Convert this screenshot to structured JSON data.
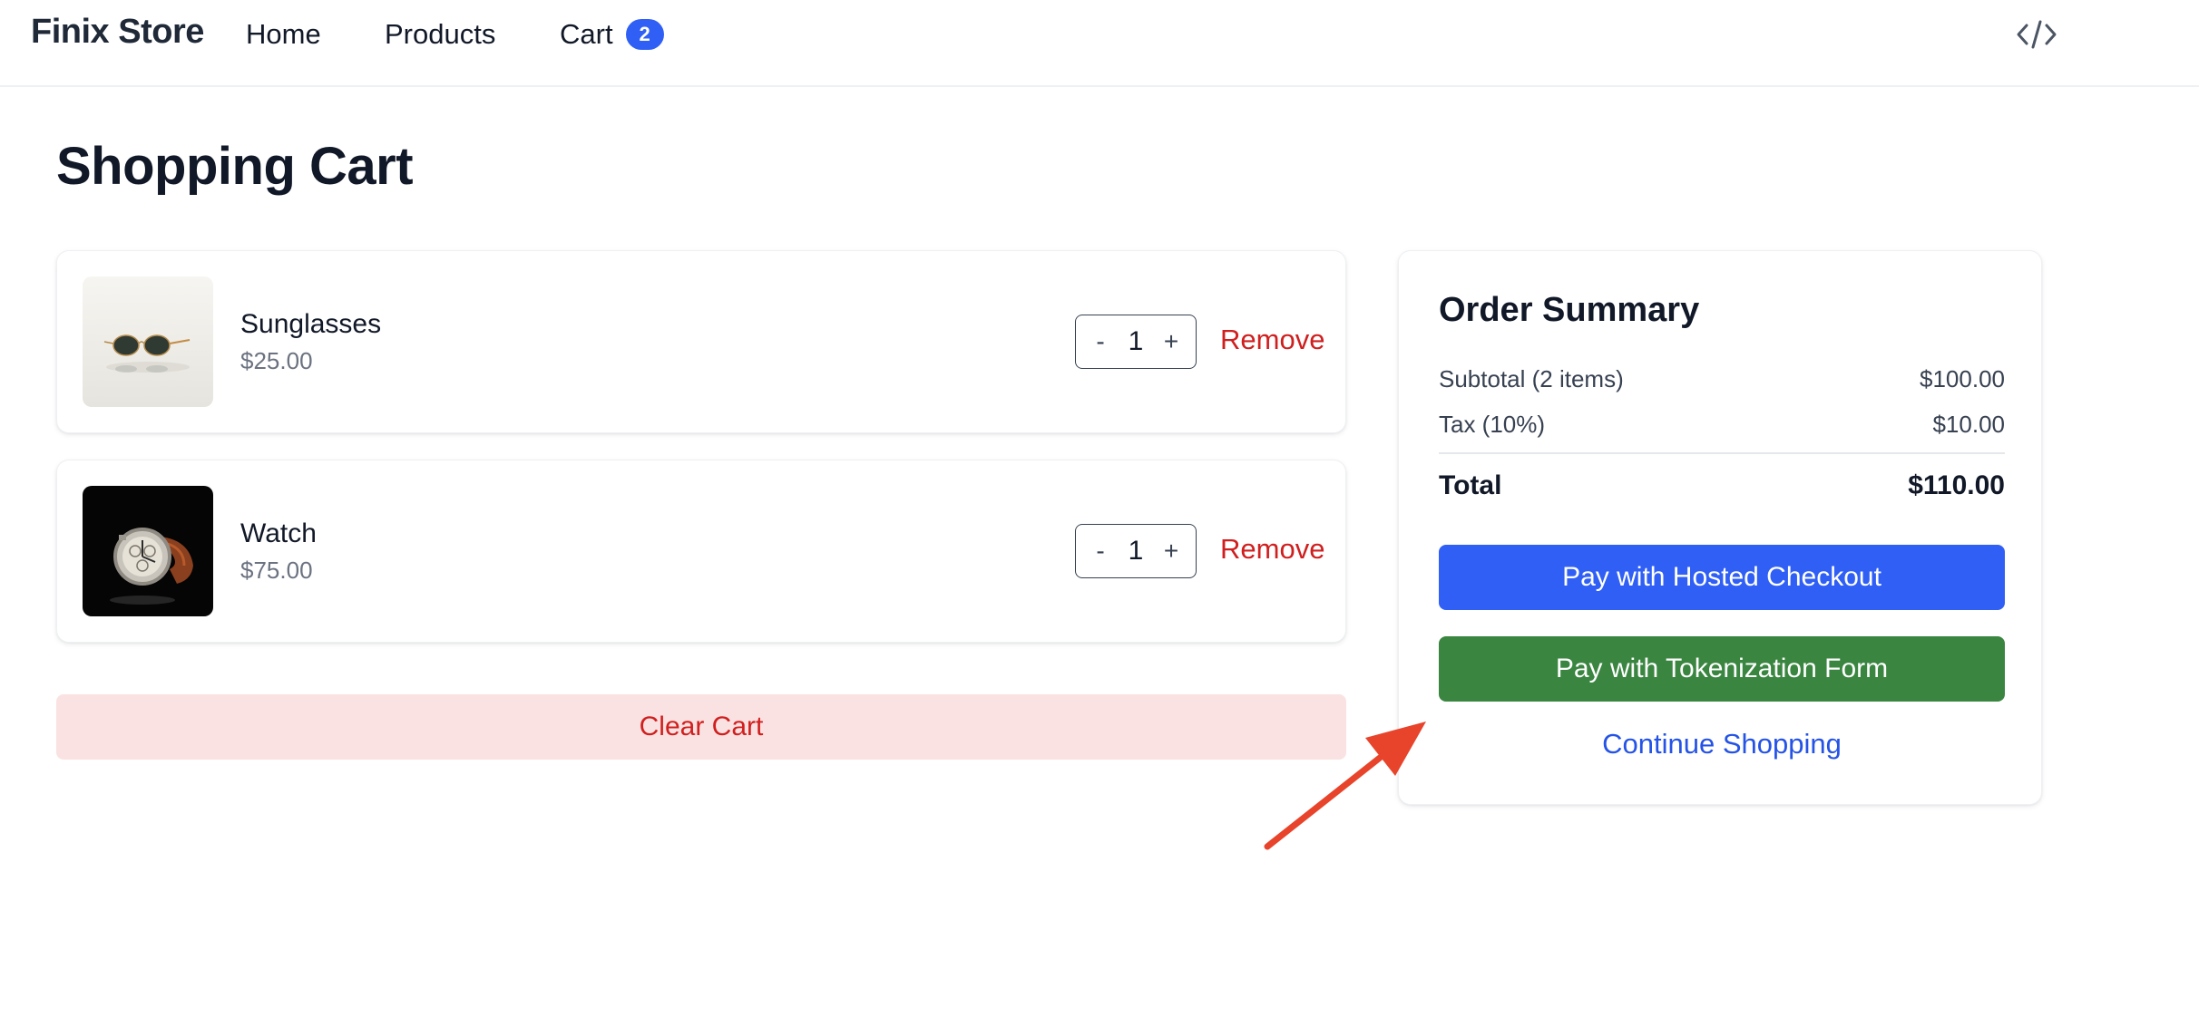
{
  "navbar": {
    "brand": "Finix Store",
    "links": {
      "home": "Home",
      "products": "Products",
      "cart": "Cart"
    },
    "cart_count": "2",
    "dev_icon": "code-icon"
  },
  "page": {
    "title": "Shopping Cart"
  },
  "cart": {
    "items": [
      {
        "name": "Sunglasses",
        "price": "$25.00",
        "quantity": "1",
        "decrement_label": "-",
        "increment_label": "+",
        "remove_label": "Remove",
        "image": "sunglasses-image"
      },
      {
        "name": "Watch",
        "price": "$75.00",
        "quantity": "1",
        "decrement_label": "-",
        "increment_label": "+",
        "remove_label": "Remove",
        "image": "watch-image"
      }
    ],
    "clear_label": "Clear Cart"
  },
  "summary": {
    "title": "Order Summary",
    "subtotal_label": "Subtotal (2 items)",
    "subtotal_value": "$100.00",
    "tax_label": "Tax (10%)",
    "tax_value": "$10.00",
    "total_label": "Total",
    "total_value": "$110.00",
    "hosted_checkout_label": "Pay with Hosted Checkout",
    "tokenization_label": "Pay with Tokenization Form",
    "continue_label": "Continue Shopping"
  },
  "colors": {
    "primary_blue": "#2f5ff5",
    "success_green": "#3a8540",
    "danger_red": "#d01f1f",
    "danger_bg": "#fbe2e2",
    "link_blue": "#2453e6",
    "annotation_arrow": "#e8432b"
  }
}
